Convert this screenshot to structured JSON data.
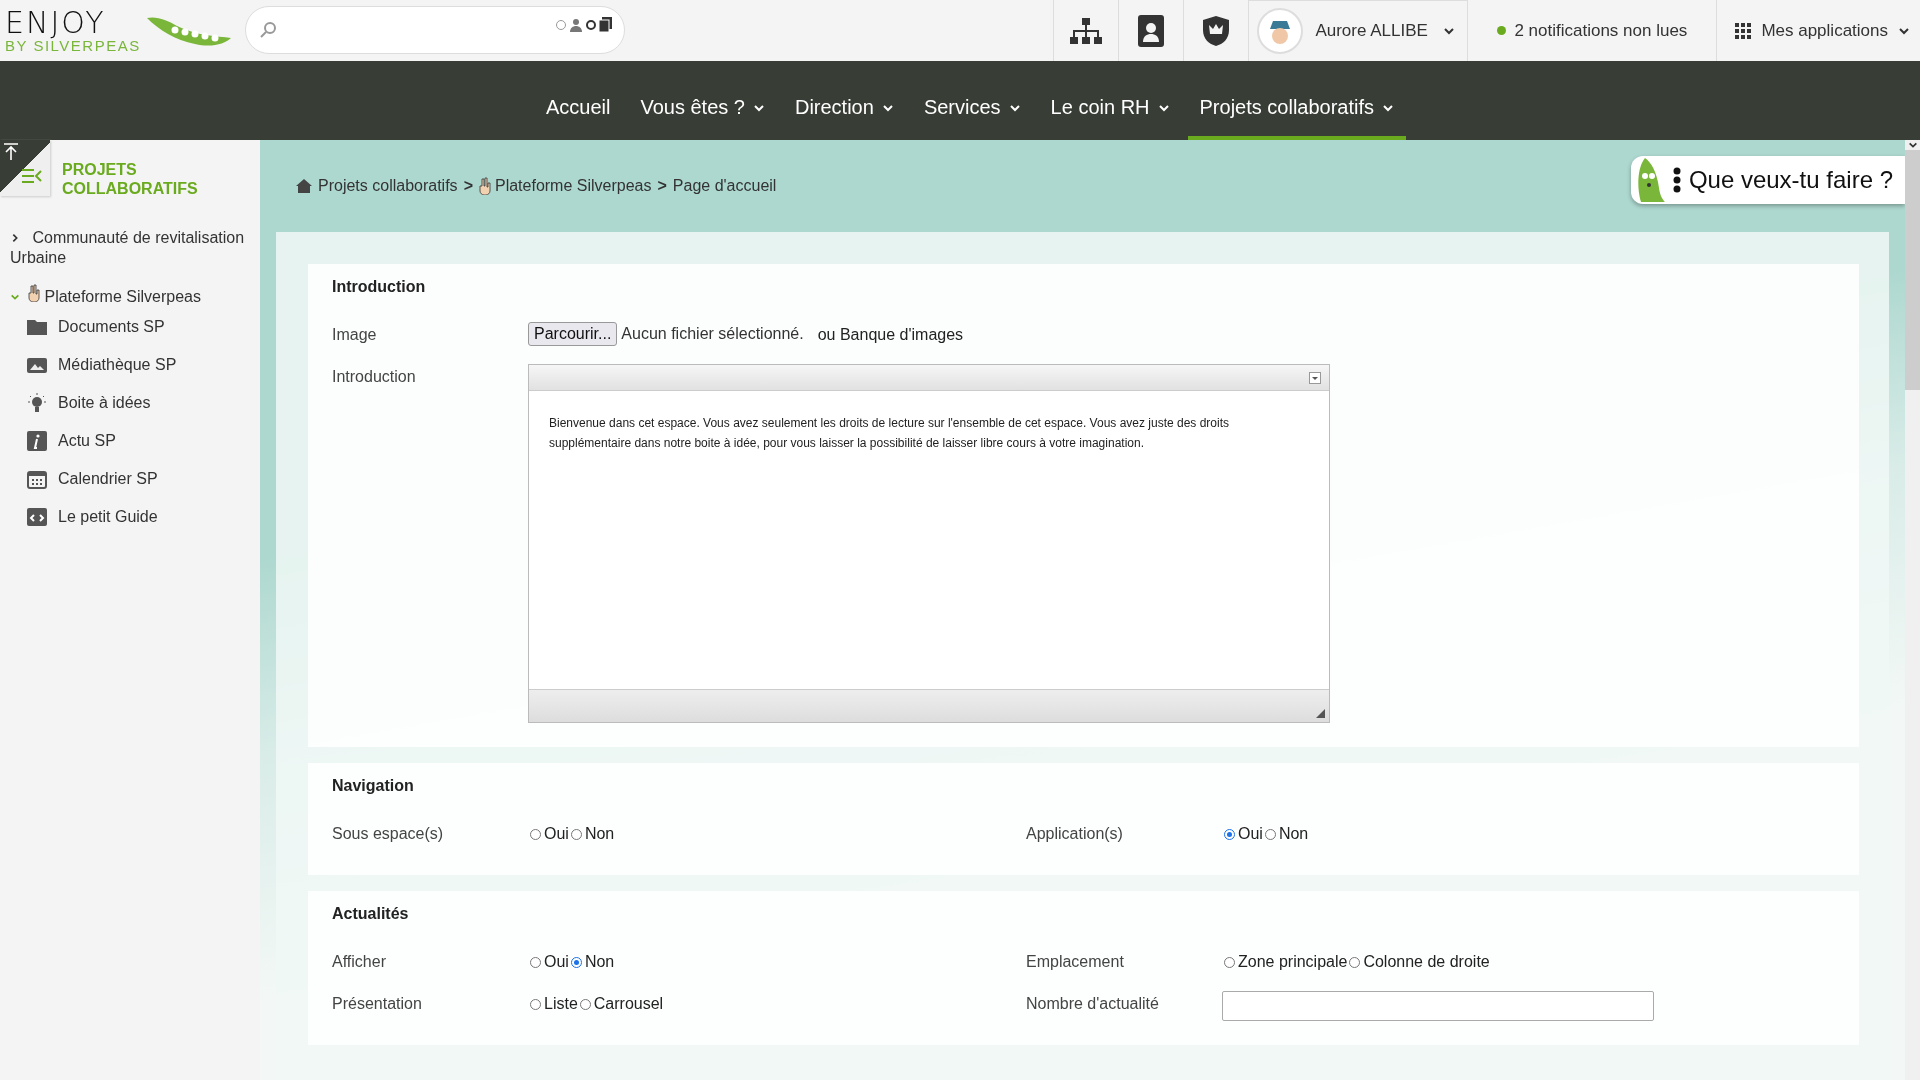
{
  "header": {
    "logo": {
      "line1": "ENJOY",
      "line2": "BY SILVERPEAS"
    },
    "user": {
      "name": "Aurore ALLIBE"
    },
    "notifications": "2 notifications non lues",
    "apps": "Mes applications"
  },
  "nav": [
    {
      "label": "Accueil",
      "dropdown": false,
      "selected": false
    },
    {
      "label": "Vous êtes ?",
      "dropdown": true,
      "selected": false
    },
    {
      "label": "Direction",
      "dropdown": true,
      "selected": false
    },
    {
      "label": "Services",
      "dropdown": true,
      "selected": false
    },
    {
      "label": "Le coin RH",
      "dropdown": true,
      "selected": false
    },
    {
      "label": "Projets collaboratifs",
      "dropdown": true,
      "selected": true
    }
  ],
  "sidebar": {
    "title": "PROJETS COLLABORATIFS",
    "tree": [
      {
        "label": "Communauté de revitalisation Urbaine",
        "expanded": false,
        "hand": false
      },
      {
        "label": "Plateforme Silverpeas",
        "expanded": true,
        "hand": true,
        "children": [
          {
            "label": "Documents SP",
            "kind": "folder"
          },
          {
            "label": "Médiathèque SP",
            "kind": "media"
          },
          {
            "label": "Boite à idées",
            "kind": "idea"
          },
          {
            "label": "Actu SP",
            "kind": "info"
          },
          {
            "label": "Calendrier SP",
            "kind": "calendar"
          },
          {
            "label": "Le petit Guide",
            "kind": "guide"
          }
        ]
      }
    ]
  },
  "breadcrumb": [
    {
      "kind": "link",
      "label": "Projets collaboratifs",
      "hand": false
    },
    {
      "kind": "separator",
      "label": ">"
    },
    {
      "kind": "link",
      "label": "Plateforme Silverpeas",
      "hand": true
    },
    {
      "kind": "separator",
      "label": ">"
    },
    {
      "kind": "current",
      "label": "Page d'accueil"
    }
  ],
  "help_button": "Que veux-tu faire ?",
  "sections": [
    {
      "title": "Introduction",
      "rows": [
        {
          "kind": "file",
          "label": "Image",
          "button": "Parcourir...",
          "status": "Aucun fichier sélectionné.",
          "link": "ou Banque d'images"
        },
        {
          "kind": "editor",
          "label": "Introduction",
          "text": "Bienvenue dans cet espace. Vous avez seulement les droits de lecture sur l'ensemble de cet espace. Vous avez juste des droits supplémentaire dans notre boite à idée, pour vous laisser la possibilité de laisser libre cours à votre imagination."
        }
      ]
    },
    {
      "title": "Navigation",
      "rows": [
        {
          "kind": "pair",
          "fields": [
            {
              "kind": "radio",
              "label": "Sous espace(s)",
              "options": [
                {
                  "label": "Oui",
                  "selected": false
                },
                {
                  "label": "Non",
                  "selected": false
                }
              ]
            },
            {
              "kind": "radio",
              "label": "Application(s)",
              "options": [
                {
                  "label": "Oui",
                  "selected": true
                },
                {
                  "label": "Non",
                  "selected": false
                }
              ]
            }
          ]
        }
      ]
    },
    {
      "title": "Actualités",
      "rows": [
        {
          "kind": "pair",
          "fields": [
            {
              "kind": "radio",
              "label": "Afficher",
              "options": [
                {
                  "label": "Oui",
                  "selected": false
                },
                {
                  "label": "Non",
                  "selected": true
                }
              ]
            },
            {
              "kind": "radio",
              "label": "Emplacement",
              "options": [
                {
                  "label": "Zone principale",
                  "selected": false
                },
                {
                  "label": "Colonne de droite",
                  "selected": false
                }
              ]
            }
          ]
        },
        {
          "kind": "pair",
          "fields": [
            {
              "kind": "radio",
              "label": "Présentation",
              "options": [
                {
                  "label": "Liste",
                  "selected": false
                },
                {
                  "label": "Carrousel",
                  "selected": false
                }
              ]
            },
            {
              "kind": "input",
              "label": "Nombre d'actualité"
            }
          ]
        }
      ]
    }
  ]
}
